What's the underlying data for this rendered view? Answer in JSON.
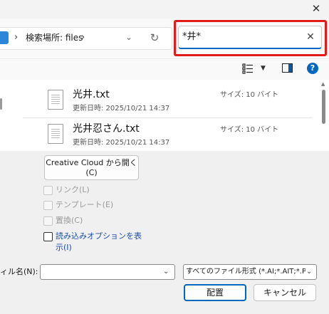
{
  "dialog": {
    "close_glyph": "✕"
  },
  "address_bar": {
    "path_separator": "›",
    "location_text": "検索場所: files",
    "dropdown_glyph": "⌄",
    "refresh_glyph": "↻"
  },
  "search": {
    "value": "*井*",
    "clear_glyph": "✕"
  },
  "toolbar": {
    "view_caret": "▼",
    "help_glyph": "?"
  },
  "files": [
    {
      "name": "光井.txt",
      "modified_label": "更新日時: 2025/10/21 14:37",
      "size_label": "サイズ: 10 バイト"
    },
    {
      "name": "光井忍さん.txt",
      "modified_label": "更新日時: 2025/10/21 14:37",
      "size_label": "サイズ: 10 バイト"
    }
  ],
  "creative_cloud_button": {
    "line1": "Creative Cloud から開く",
    "line2": "(C)"
  },
  "options": [
    {
      "label": "リンク(L)",
      "enabled": false
    },
    {
      "label": "テンプレート(E)",
      "enabled": false
    },
    {
      "label": "置換(C)",
      "enabled": false
    },
    {
      "label_line1": "読み込みオプションを表",
      "label_line2": "示(I)",
      "enabled": true
    }
  ],
  "filename": {
    "label": "ィル名(N):",
    "value": "",
    "caret": "⌄"
  },
  "filetype": {
    "selected": "すべてのファイル形式 (*.AI;*.AIT;*.PDF",
    "caret": "⌄"
  },
  "buttons": {
    "place": "配置",
    "cancel": "キャンセル"
  },
  "colors": {
    "accent": "#0067c0",
    "highlight": "#e21a1a",
    "link_blue": "#1a4fa8"
  },
  "icons": [
    "drive-icon",
    "close-icon",
    "refresh-icon",
    "search-clear-icon",
    "view-options-icon",
    "preview-pane-icon",
    "help-icon",
    "text-file-icon"
  ]
}
